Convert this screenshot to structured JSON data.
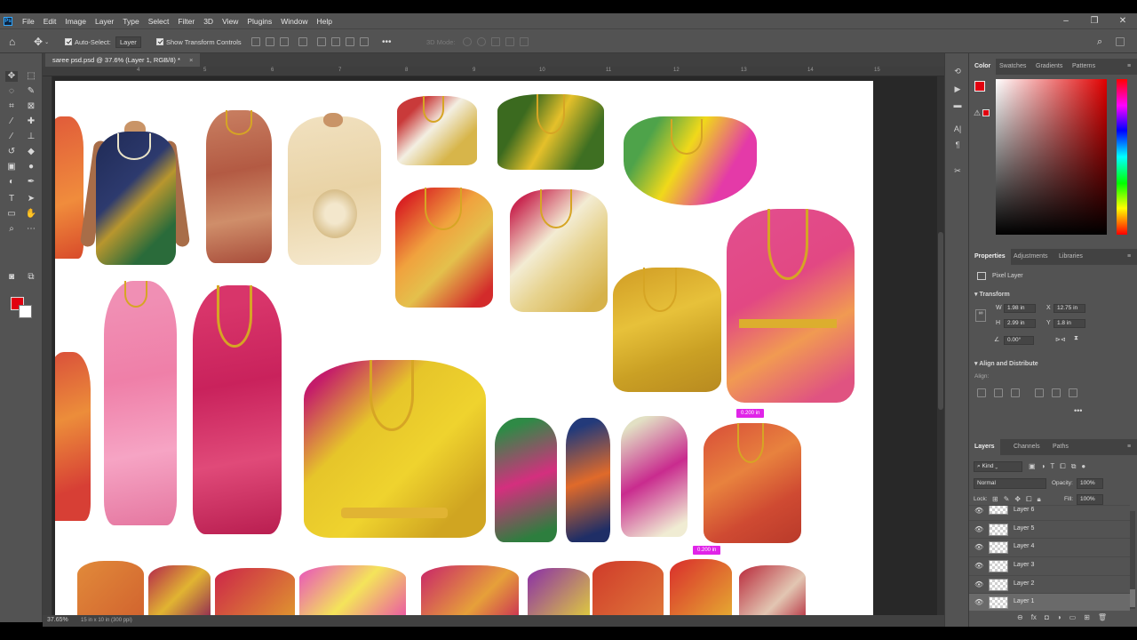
{
  "menubar": {
    "logo": "Ps",
    "items": [
      "File",
      "Edit",
      "Image",
      "Layer",
      "Type",
      "Select",
      "Filter",
      "3D",
      "View",
      "Plugins",
      "Window",
      "Help"
    ],
    "window_controls": [
      "–",
      "❐",
      "✕"
    ]
  },
  "options": {
    "auto_select_label": "Auto-Select:",
    "auto_select_target": "Layer",
    "show_transform_label": "Show Transform Controls",
    "mode_3d_label": "3D Mode:"
  },
  "document": {
    "tab_title": "saree psd.psd @ 37.6% (Layer 1, RGB/8) *",
    "ruler_ticks": [
      "4",
      "5",
      "6",
      "7",
      "8",
      "9",
      "10",
      "11",
      "12",
      "13",
      "14",
      "15"
    ],
    "selection_labels": [
      "0.200 in",
      "0.200 in"
    ]
  },
  "status": {
    "zoom": "37.65%",
    "doc_size": "15 in x 10 in (300 ppi)"
  },
  "color_panel": {
    "tabs": [
      "Color",
      "Swatches",
      "Gradients",
      "Patterns"
    ],
    "foreground": "#e1000f",
    "background": "#ffffff"
  },
  "properties_panel": {
    "tabs": [
      "Properties",
      "Adjustments",
      "Libraries"
    ],
    "layer_type": "Pixel Layer",
    "transform_title": "Transform",
    "w_label": "W",
    "w_value": "1.98 in",
    "x_label": "X",
    "x_value": "12.75 in",
    "h_label": "H",
    "h_value": "2.99 in",
    "y_label": "Y",
    "y_value": "1.8 in",
    "angle": "0.00°",
    "align_title": "Align and Distribute",
    "align_label": "Align:",
    "more": "•••"
  },
  "layers_panel": {
    "tabs": [
      "Layers",
      "Channels",
      "Paths"
    ],
    "kind_label": "Kind",
    "blend_mode": "Normal",
    "opacity_label": "Opacity:",
    "opacity_value": "100%",
    "lock_label": "Lock:",
    "fill_label": "Fill:",
    "fill_value": "100%",
    "layers": [
      "Layer 6",
      "Layer 5",
      "Layer 4",
      "Layer 3",
      "Layer 2",
      "Layer 1"
    ],
    "active_layer": "Layer 1"
  }
}
